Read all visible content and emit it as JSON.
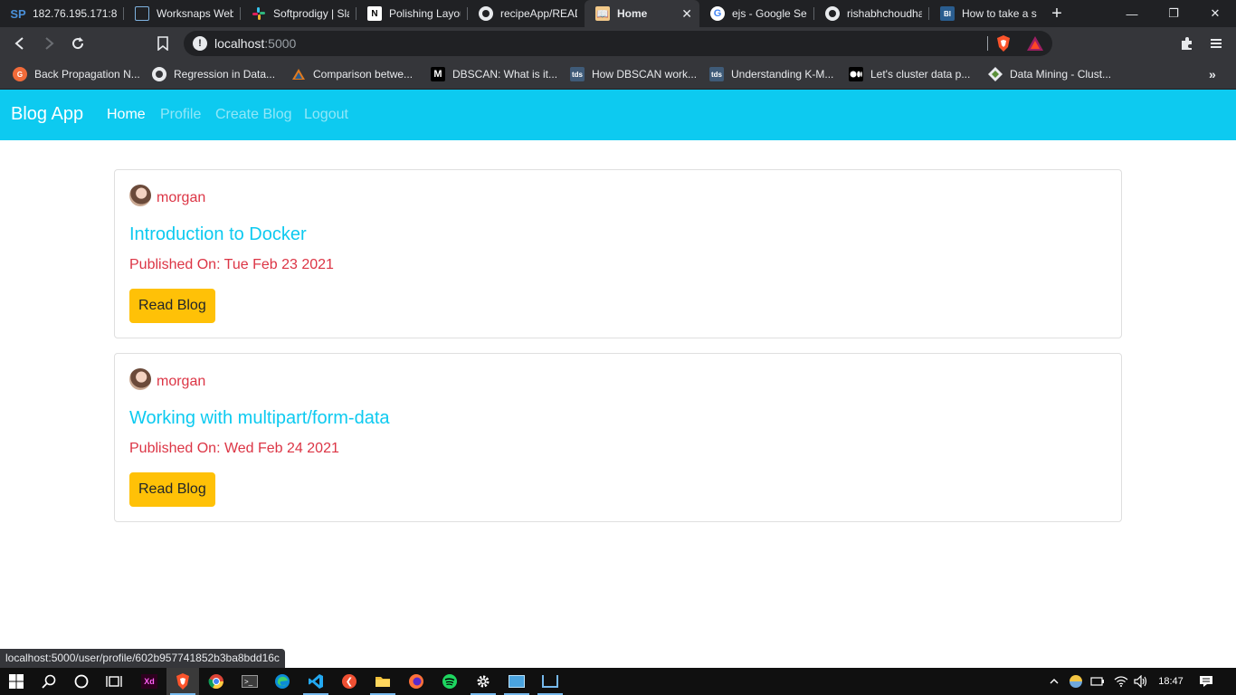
{
  "browser": {
    "tabs": [
      {
        "title": "182.76.195.171:8",
        "icon": "sp-icon",
        "active": false
      },
      {
        "title": "Worksnaps Web",
        "icon": "worksnaps-icon",
        "active": false
      },
      {
        "title": "Softprodigy | Slac",
        "icon": "slack-icon",
        "active": false
      },
      {
        "title": "Polishing Layout",
        "icon": "notion-icon",
        "active": false
      },
      {
        "title": "recipeApp/READI",
        "icon": "github-icon",
        "active": false
      },
      {
        "title": "Home",
        "icon": "book-icon",
        "active": true
      },
      {
        "title": "ejs - Google Sear",
        "icon": "google-icon",
        "active": false
      },
      {
        "title": "rishabhchoudhar",
        "icon": "github-icon",
        "active": false
      },
      {
        "title": "How to take a sc",
        "icon": "bi-icon",
        "active": false
      }
    ],
    "address": {
      "host": "localhost",
      "port": ":5000"
    },
    "bookmarks": [
      {
        "label": "Back Propagation N...",
        "icon": "orange-circle-icon"
      },
      {
        "label": "Regression in Data...",
        "icon": "globe-icon"
      },
      {
        "label": "Comparison betwe...",
        "icon": "triangle-icon"
      },
      {
        "label": "DBSCAN: What is it...",
        "icon": "medium-icon"
      },
      {
        "label": "How DBSCAN work...",
        "icon": "tds-icon"
      },
      {
        "label": "Understanding K-M...",
        "icon": "tds-icon"
      },
      {
        "label": "Let's cluster data p...",
        "icon": "medium-dots-icon"
      },
      {
        "label": "Data Mining - Clust...",
        "icon": "diamond-icon"
      }
    ],
    "status_url": "localhost:5000/user/profile/602b957741852b3ba8bdd16c"
  },
  "app": {
    "brand": "Blog App",
    "nav": [
      {
        "label": "Home",
        "active": true
      },
      {
        "label": "Profile",
        "active": false
      },
      {
        "label": "Create Blog",
        "active": false
      },
      {
        "label": "Logout",
        "active": false
      }
    ],
    "posts": [
      {
        "author": "morgan",
        "title": "Introduction to Docker",
        "published": "Published On: Tue Feb 23 2021",
        "button": "Read Blog"
      },
      {
        "author": "morgan",
        "title": "Working with multipart/form-data",
        "published": "Published On: Wed Feb 24 2021",
        "button": "Read Blog"
      }
    ]
  },
  "taskbar": {
    "clock": "18:47"
  },
  "colors": {
    "navbar": "#0dcaf0",
    "title": "#0dcaf0",
    "danger_text": "#dc3545",
    "button": "#ffc107"
  }
}
